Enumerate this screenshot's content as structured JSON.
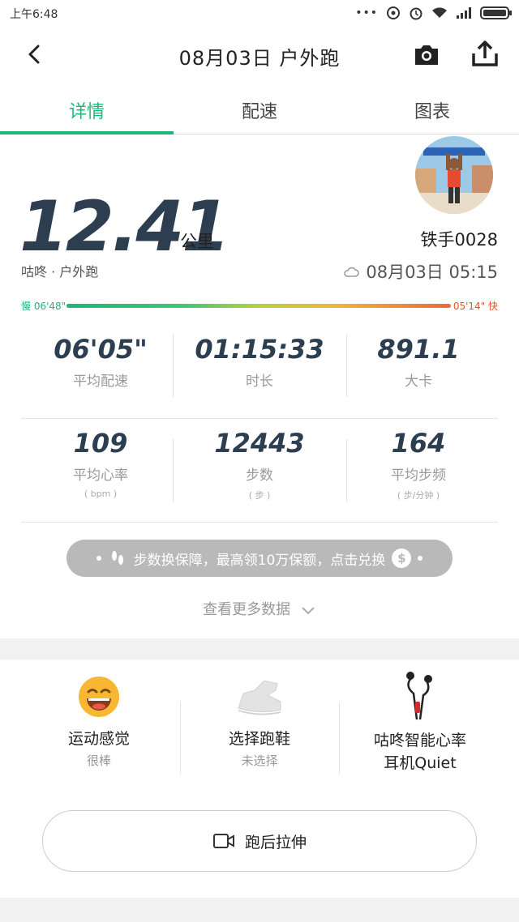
{
  "status": {
    "time": "上午6:48"
  },
  "header": {
    "title": "08月03日 户外跑"
  },
  "tabs": [
    {
      "label": "详情",
      "active": true
    },
    {
      "label": "配速",
      "active": false
    },
    {
      "label": "图表",
      "active": false
    }
  ],
  "summary": {
    "distance": "12.41",
    "unit": "公里",
    "username": "铁手0028",
    "subtitle": "咕咚 · 户外跑",
    "datetime": "08月03日  05:15"
  },
  "pace": {
    "slow_label": "慢 06'48\"",
    "fast_label": "05'14\" 快"
  },
  "stats": [
    {
      "value": "06'05\"",
      "label": "平均配速",
      "unit": ""
    },
    {
      "value": "01:15:33",
      "label": "时长",
      "unit": ""
    },
    {
      "value": "891.1",
      "label": "大卡",
      "unit": ""
    },
    {
      "value": "109",
      "label": "平均心率",
      "unit": "( bpm )"
    },
    {
      "value": "12443",
      "label": "步数",
      "unit": "( 步 )"
    },
    {
      "value": "164",
      "label": "平均步频",
      "unit": "( 步/分钟 )"
    }
  ],
  "promo": {
    "text": "步数换保障，最高领10万保额，点击兑换"
  },
  "more_label": "查看更多数据",
  "features": [
    {
      "name": "运动感觉",
      "sub": "很棒",
      "icon": "happy-face-icon"
    },
    {
      "name": "选择跑鞋",
      "sub": "未选择",
      "icon": "running-shoe-icon"
    },
    {
      "name": "咕咚智能心率\n耳机Quiet",
      "sub": "",
      "icon": "earphone-icon"
    }
  ],
  "stretch_label": "跑后拉伸",
  "colors": {
    "accent": "#1bb87a",
    "fast": "#e8502d",
    "stat_value": "#2c3e50"
  }
}
